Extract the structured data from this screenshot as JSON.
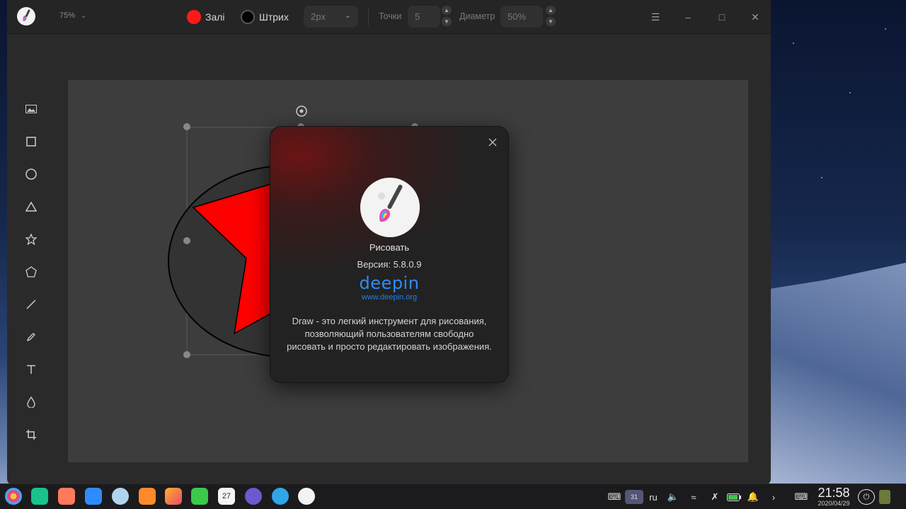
{
  "window": {
    "zoom": "75%",
    "fill_label": "Залі",
    "fill_color": "#ff1a1a",
    "stroke_label": "Штрих",
    "stroke_color": "#000000",
    "stroke_width": "2px",
    "points_label": "Точки",
    "points_value": "5",
    "diameter_label": "Диаметр",
    "diameter_value": "50%"
  },
  "tools": [
    "image-icon",
    "rectangle-icon",
    "ellipse-icon",
    "triangle-icon",
    "star-icon",
    "polygon-icon",
    "line-icon",
    "pencil-icon",
    "text-icon",
    "blur-icon",
    "crop-icon"
  ],
  "dialog": {
    "app_name": "Рисовать",
    "version": "Версия: 5.8.0.9",
    "brand": "deepin",
    "url": "www.deepin.org",
    "description": "Draw - это легкий инструмент для рисования, позволяющий пользователям свободно рисовать и просто редактировать изображения."
  },
  "tray": {
    "keyboard_layout": "ru",
    "calendar_day": "27",
    "clock_time": "21:58",
    "clock_date": "2020/04/29"
  },
  "colors": {
    "accent": "#2e8cff",
    "canvas_bg": "#3d3d3d",
    "star_fill": "#ff0000"
  }
}
